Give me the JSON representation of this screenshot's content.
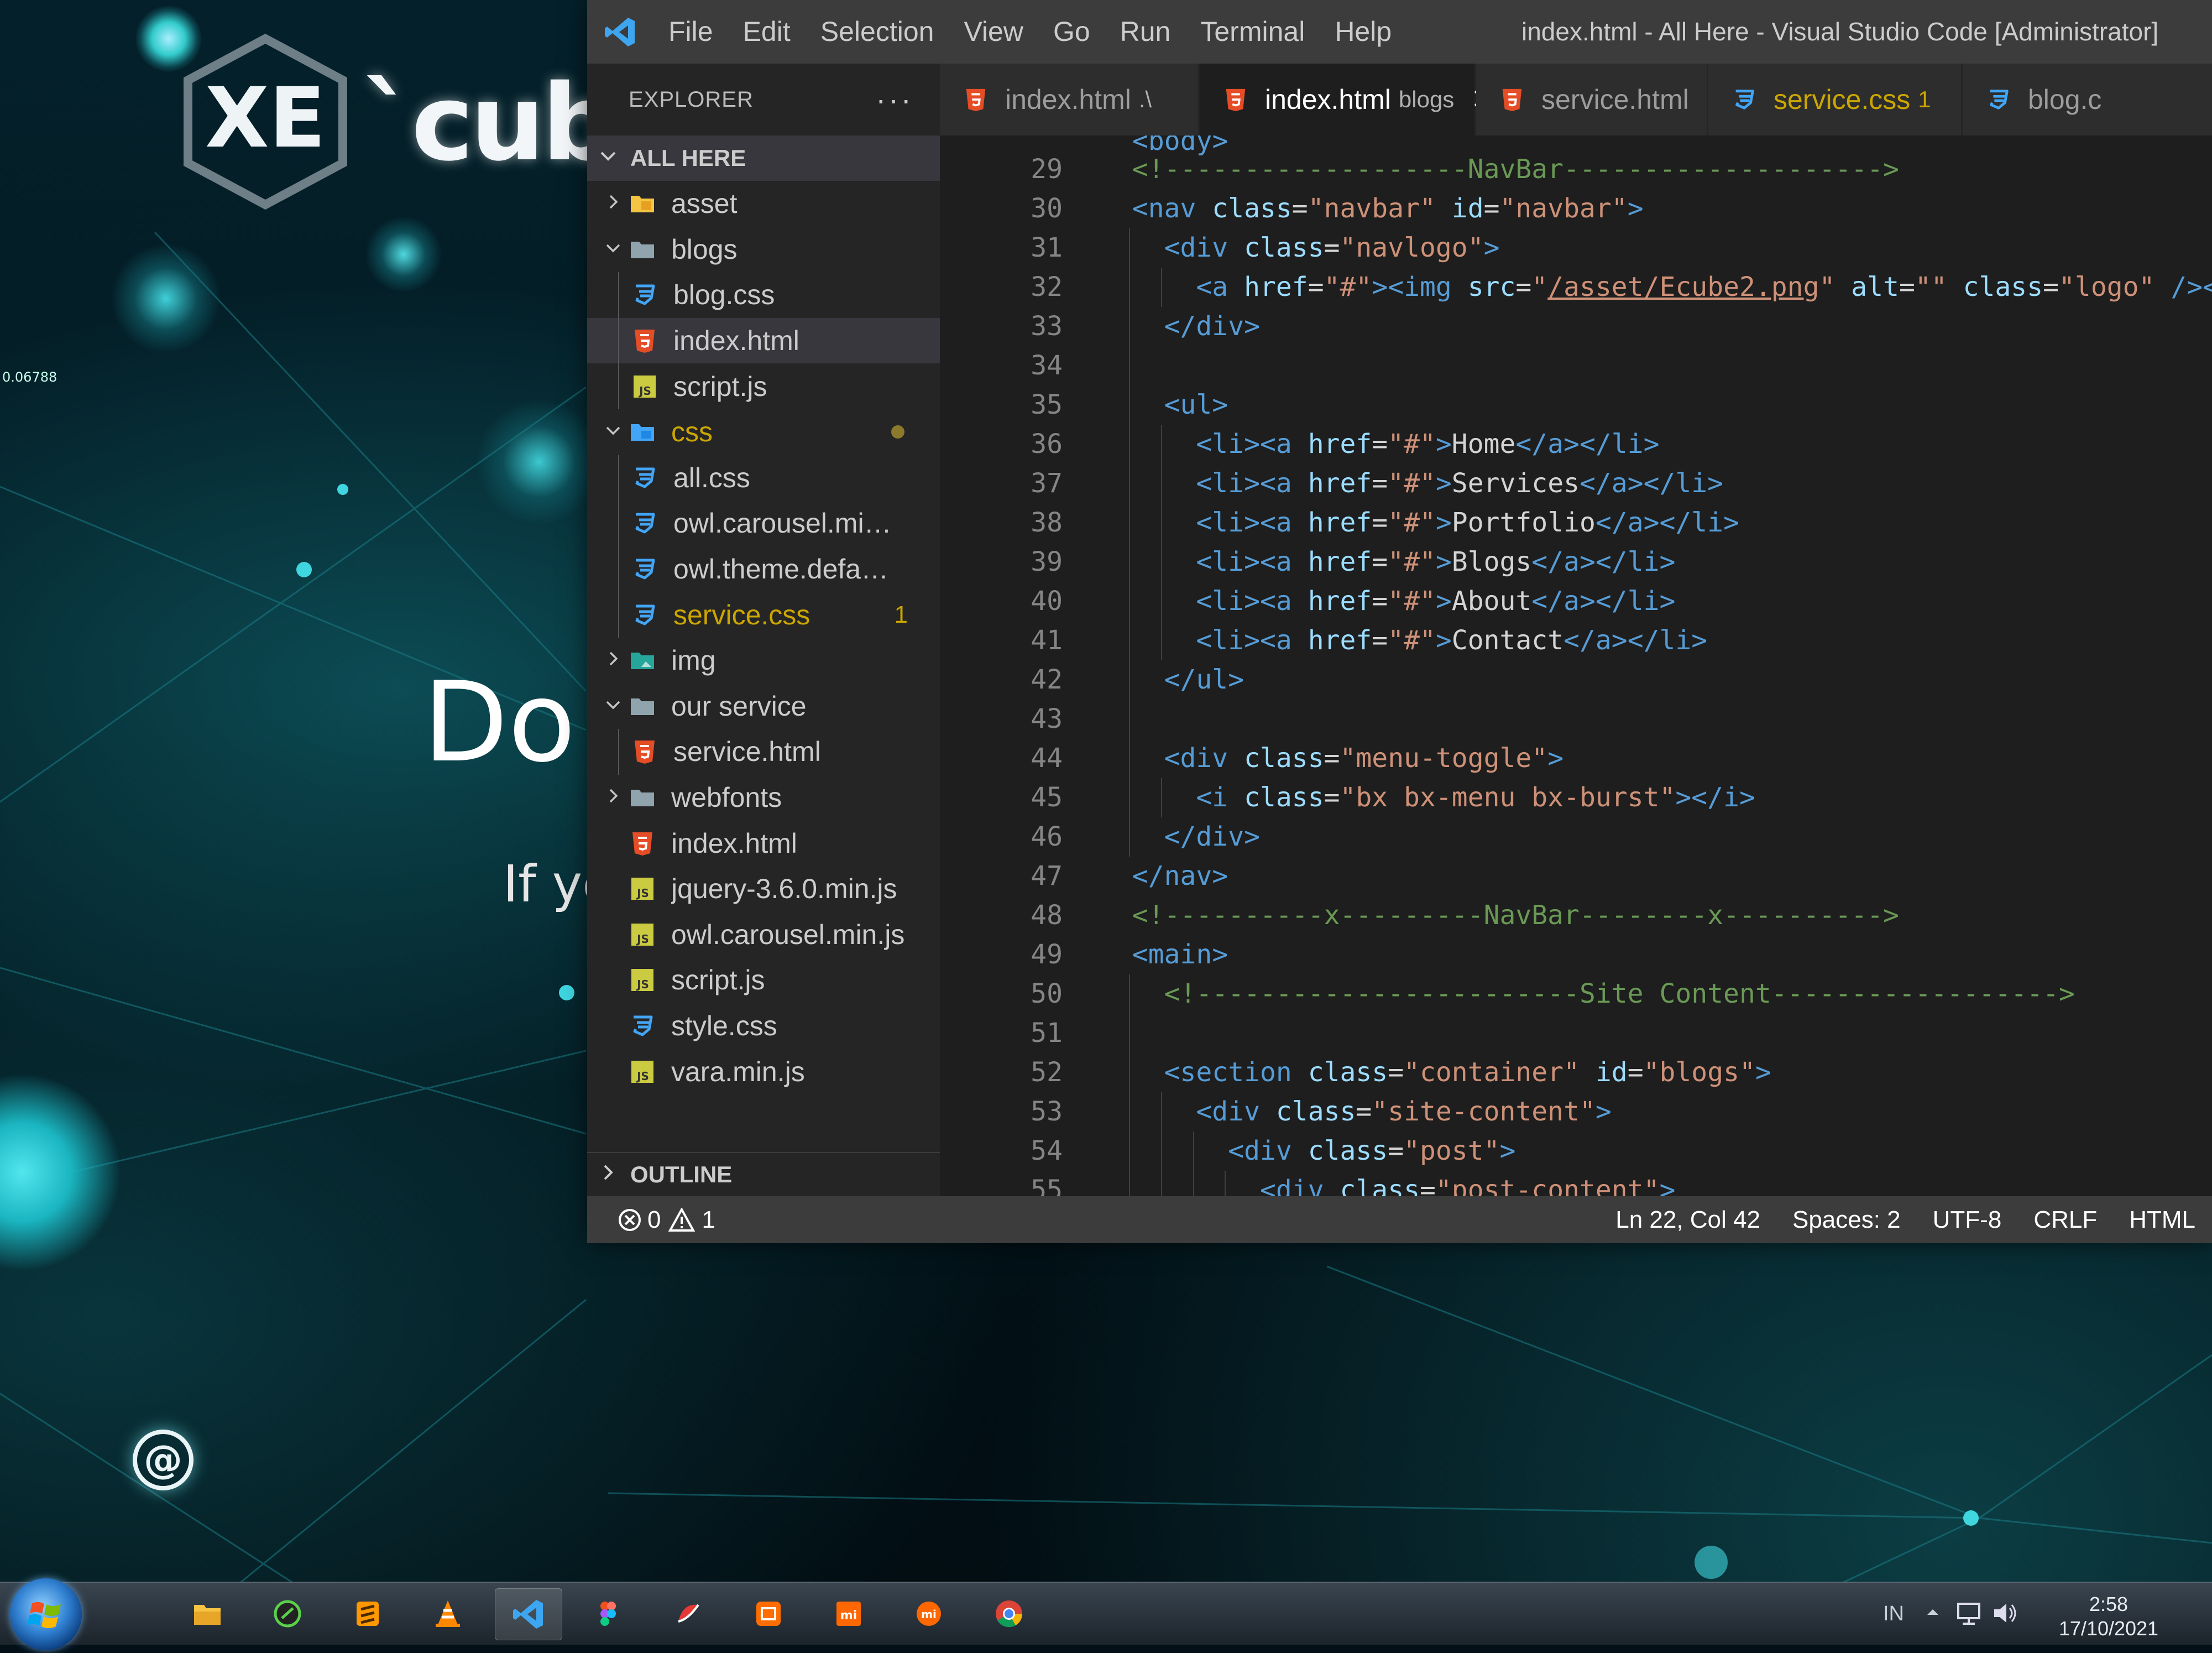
{
  "desktop": {
    "logo_text": "`cube",
    "hero_heading": "Do '",
    "hero_subtext": "If ye",
    "side_number": "0.06788",
    "email_symbol": "@"
  },
  "window": {
    "title": "index.html - All Here - Visual Studio Code [Administrator]",
    "menu": [
      "File",
      "Edit",
      "Selection",
      "View",
      "Go",
      "Run",
      "Terminal",
      "Help"
    ]
  },
  "sidebar": {
    "title": "EXPLORER",
    "more": "···",
    "root": "ALL HERE",
    "outline": "OUTLINE",
    "tree": [
      {
        "name": "asset",
        "kind": "folder-asset",
        "depth": 1,
        "expanded": false
      },
      {
        "name": "blogs",
        "kind": "folder",
        "depth": 1,
        "expanded": true
      },
      {
        "name": "blog.css",
        "kind": "css",
        "depth": 2
      },
      {
        "name": "index.html",
        "kind": "html",
        "depth": 2,
        "selected": true
      },
      {
        "name": "script.js",
        "kind": "js",
        "depth": 2
      },
      {
        "name": "css",
        "kind": "folder-css",
        "depth": 1,
        "expanded": true,
        "modified": true
      },
      {
        "name": "all.css",
        "kind": "css",
        "depth": 2
      },
      {
        "name": "owl.carousel.min...",
        "kind": "css",
        "depth": 2
      },
      {
        "name": "owl.theme.defau...",
        "kind": "css",
        "depth": 2
      },
      {
        "name": "service.css",
        "kind": "css",
        "depth": 2,
        "modified": true,
        "badge": "1"
      },
      {
        "name": "img",
        "kind": "folder-img",
        "depth": 1,
        "expanded": false
      },
      {
        "name": "our service",
        "kind": "folder",
        "depth": 1,
        "expanded": true
      },
      {
        "name": "service.html",
        "kind": "html",
        "depth": 2
      },
      {
        "name": "webfonts",
        "kind": "folder",
        "depth": 1,
        "expanded": false
      },
      {
        "name": "index.html",
        "kind": "html",
        "depth": 1
      },
      {
        "name": "jquery-3.6.0.min.js",
        "kind": "js",
        "depth": 1
      },
      {
        "name": "owl.carousel.min.js",
        "kind": "js",
        "depth": 1
      },
      {
        "name": "script.js",
        "kind": "js",
        "depth": 1
      },
      {
        "name": "style.css",
        "kind": "css",
        "depth": 1
      },
      {
        "name": "vara.min.js",
        "kind": "js",
        "depth": 1
      }
    ]
  },
  "tabs": [
    {
      "name": "index.html",
      "desc": ".\\",
      "kind": "html"
    },
    {
      "name": "index.html",
      "desc": "blogs",
      "kind": "html",
      "active": true,
      "close": "✕"
    },
    {
      "name": "service.html",
      "desc": "",
      "kind": "html"
    },
    {
      "name": "service.css",
      "desc": "1",
      "kind": "css",
      "warn": true
    },
    {
      "name": "blog.c",
      "desc": "",
      "kind": "css"
    }
  ],
  "editor": {
    "top_partial": "<body>",
    "lines": [
      {
        "n": "29",
        "i": 1,
        "t": [
          [
            "com",
            "<!-------------------NavBar-------------------->"
          ]
        ]
      },
      {
        "n": "30",
        "i": 1,
        "t": [
          [
            "tag",
            "<nav "
          ],
          [
            "attr",
            "class"
          ],
          [
            "txt",
            "="
          ],
          [
            "str",
            "\"navbar\""
          ],
          [
            "txt",
            " "
          ],
          [
            "attr",
            "id"
          ],
          [
            "txt",
            "="
          ],
          [
            "str",
            "\"navbar\""
          ],
          [
            "tag",
            ">"
          ]
        ]
      },
      {
        "n": "31",
        "i": 2,
        "t": [
          [
            "tag",
            "<div "
          ],
          [
            "attr",
            "class"
          ],
          [
            "txt",
            "="
          ],
          [
            "str",
            "\"navlogo\""
          ],
          [
            "tag",
            ">"
          ]
        ]
      },
      {
        "n": "32",
        "i": 3,
        "t": [
          [
            "tag",
            "<a "
          ],
          [
            "attr",
            "href"
          ],
          [
            "txt",
            "="
          ],
          [
            "str",
            "\"#\""
          ],
          [
            "tag",
            "><img "
          ],
          [
            "attr",
            "src"
          ],
          [
            "txt",
            "="
          ],
          [
            "str",
            "\""
          ],
          [
            "link",
            "/asset/Ecube2.png"
          ],
          [
            "str",
            "\""
          ],
          [
            "txt",
            " "
          ],
          [
            "attr",
            "alt"
          ],
          [
            "txt",
            "="
          ],
          [
            "str",
            "\"\""
          ],
          [
            "txt",
            " "
          ],
          [
            "attr",
            "class"
          ],
          [
            "txt",
            "="
          ],
          [
            "str",
            "\"logo\""
          ],
          [
            "txt",
            " "
          ],
          [
            "tag",
            "/></a>"
          ]
        ]
      },
      {
        "n": "33",
        "i": 2,
        "t": [
          [
            "tag",
            "</div>"
          ]
        ]
      },
      {
        "n": "34",
        "i": 2,
        "t": []
      },
      {
        "n": "35",
        "i": 2,
        "t": [
          [
            "tag",
            "<ul>"
          ]
        ]
      },
      {
        "n": "36",
        "i": 3,
        "t": [
          [
            "tag",
            "<li><a "
          ],
          [
            "attr",
            "href"
          ],
          [
            "txt",
            "="
          ],
          [
            "str",
            "\"#\""
          ],
          [
            "tag",
            ">"
          ],
          [
            "txt",
            "Home"
          ],
          [
            "tag",
            "</a></li>"
          ]
        ]
      },
      {
        "n": "37",
        "i": 3,
        "t": [
          [
            "tag",
            "<li><a "
          ],
          [
            "attr",
            "href"
          ],
          [
            "txt",
            "="
          ],
          [
            "str",
            "\"#\""
          ],
          [
            "tag",
            ">"
          ],
          [
            "txt",
            "Services"
          ],
          [
            "tag",
            "</a></li>"
          ]
        ]
      },
      {
        "n": "38",
        "i": 3,
        "t": [
          [
            "tag",
            "<li><a "
          ],
          [
            "attr",
            "href"
          ],
          [
            "txt",
            "="
          ],
          [
            "str",
            "\"#\""
          ],
          [
            "tag",
            ">"
          ],
          [
            "txt",
            "Portfolio"
          ],
          [
            "tag",
            "</a></li>"
          ]
        ]
      },
      {
        "n": "39",
        "i": 3,
        "t": [
          [
            "tag",
            "<li><a "
          ],
          [
            "attr",
            "href"
          ],
          [
            "txt",
            "="
          ],
          [
            "str",
            "\"#\""
          ],
          [
            "tag",
            ">"
          ],
          [
            "txt",
            "Blogs"
          ],
          [
            "tag",
            "</a></li>"
          ]
        ]
      },
      {
        "n": "40",
        "i": 3,
        "t": [
          [
            "tag",
            "<li><a "
          ],
          [
            "attr",
            "href"
          ],
          [
            "txt",
            "="
          ],
          [
            "str",
            "\"#\""
          ],
          [
            "tag",
            ">"
          ],
          [
            "txt",
            "About"
          ],
          [
            "tag",
            "</a></li>"
          ]
        ]
      },
      {
        "n": "41",
        "i": 3,
        "t": [
          [
            "tag",
            "<li><a "
          ],
          [
            "attr",
            "href"
          ],
          [
            "txt",
            "="
          ],
          [
            "str",
            "\"#\""
          ],
          [
            "tag",
            ">"
          ],
          [
            "txt",
            "Contact"
          ],
          [
            "tag",
            "</a></li>"
          ]
        ]
      },
      {
        "n": "42",
        "i": 2,
        "t": [
          [
            "tag",
            "</ul>"
          ]
        ]
      },
      {
        "n": "43",
        "i": 2,
        "t": []
      },
      {
        "n": "44",
        "i": 2,
        "t": [
          [
            "tag",
            "<div "
          ],
          [
            "attr",
            "class"
          ],
          [
            "txt",
            "="
          ],
          [
            "str",
            "\"menu-toggle\""
          ],
          [
            "tag",
            ">"
          ]
        ]
      },
      {
        "n": "45",
        "i": 3,
        "t": [
          [
            "tag",
            "<i "
          ],
          [
            "attr",
            "class"
          ],
          [
            "txt",
            "="
          ],
          [
            "str",
            "\"bx bx-menu bx-burst\""
          ],
          [
            "tag",
            "></i>"
          ]
        ]
      },
      {
        "n": "46",
        "i": 2,
        "t": [
          [
            "tag",
            "</div>"
          ]
        ]
      },
      {
        "n": "47",
        "i": 1,
        "t": [
          [
            "tag",
            "</nav>"
          ]
        ]
      },
      {
        "n": "48",
        "i": 1,
        "t": [
          [
            "com",
            "<!----------x---------NavBar--------x---------->"
          ]
        ]
      },
      {
        "n": "49",
        "i": 1,
        "t": [
          [
            "tag",
            "<main>"
          ]
        ]
      },
      {
        "n": "50",
        "i": 2,
        "t": [
          [
            "com",
            "<!------------------------Site Content------------------>"
          ]
        ]
      },
      {
        "n": "51",
        "i": 2,
        "t": []
      },
      {
        "n": "52",
        "i": 2,
        "t": [
          [
            "tag",
            "<section "
          ],
          [
            "attr",
            "class"
          ],
          [
            "txt",
            "="
          ],
          [
            "str",
            "\"container\""
          ],
          [
            "txt",
            " "
          ],
          [
            "attr",
            "id"
          ],
          [
            "txt",
            "="
          ],
          [
            "str",
            "\"blogs\""
          ],
          [
            "tag",
            ">"
          ]
        ]
      },
      {
        "n": "53",
        "i": 3,
        "t": [
          [
            "tag",
            "<div "
          ],
          [
            "attr",
            "class"
          ],
          [
            "txt",
            "="
          ],
          [
            "str",
            "\"site-content\""
          ],
          [
            "tag",
            ">"
          ]
        ]
      },
      {
        "n": "54",
        "i": 4,
        "t": [
          [
            "tag",
            "<div "
          ],
          [
            "attr",
            "class"
          ],
          [
            "txt",
            "="
          ],
          [
            "str",
            "\"post\""
          ],
          [
            "tag",
            ">"
          ]
        ]
      },
      {
        "n": "55",
        "i": 5,
        "t": [
          [
            "tag",
            "<div "
          ],
          [
            "attr",
            "class"
          ],
          [
            "txt",
            "="
          ],
          [
            "str",
            "\"post-content\""
          ],
          [
            "tag",
            ">"
          ]
        ]
      }
    ]
  },
  "statusbar": {
    "errors": "0",
    "warnings": "1",
    "position": "Ln 22, Col 42",
    "spaces": "Spaces: 2",
    "encoding": "UTF-8",
    "eol": "CRLF",
    "language": "HTML"
  },
  "taskbar": {
    "apps": [
      "file-explorer",
      "green-app",
      "sublime-text",
      "vlc",
      "vscode",
      "figma",
      "paint-app",
      "orange-app",
      "mi-app",
      "mi-app-2",
      "chrome"
    ],
    "active_app": "vscode",
    "tray_lang": "IN",
    "time": "2:58",
    "date": "17/10/2021"
  },
  "colors": {
    "accent": "#007acc",
    "warning": "#cca700",
    "html_icon": "#e44d26",
    "css_icon": "#42a5f5",
    "js_icon": "#cbcb41"
  }
}
